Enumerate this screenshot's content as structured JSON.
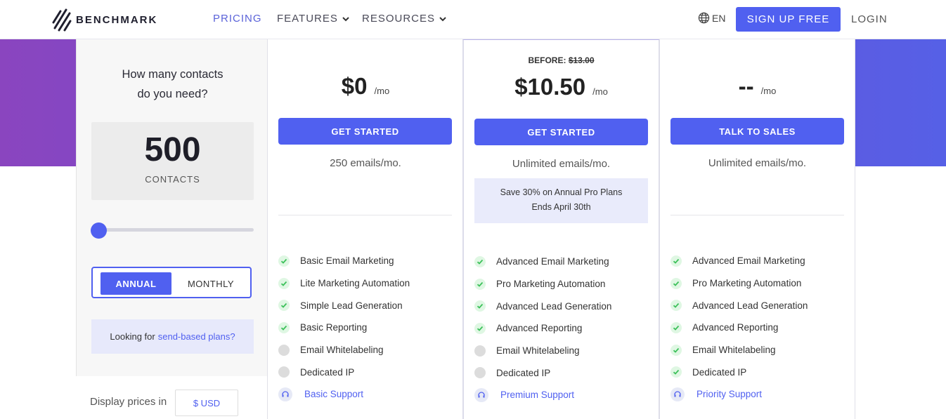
{
  "header": {
    "logo_text": "BENCHMARK",
    "nav": [
      {
        "label": "PRICING",
        "active": true,
        "dropdown": false
      },
      {
        "label": "FEATURES",
        "active": false,
        "dropdown": true
      },
      {
        "label": "RESOURCES",
        "active": false,
        "dropdown": true
      }
    ],
    "lang": "EN",
    "signup": "SIGN UP FREE",
    "login": "LOGIN"
  },
  "sidebar": {
    "question": "How many contacts\ndo you need?",
    "contacts_value": "500",
    "contacts_label": "CONTACTS",
    "slider_value": 0,
    "toggle": {
      "annual": "ANNUAL",
      "monthly": "MONTHLY",
      "selected": "ANNUAL"
    },
    "send_based_prefix": "Looking for",
    "send_based_link": "send-based plans?",
    "display_prices": "Display prices in",
    "currency": "$ USD"
  },
  "plans": [
    {
      "before_label": "",
      "before_price": "",
      "price": "$0",
      "per": "/mo",
      "button": "GET STARTED",
      "emails": "250 emails/mo.",
      "promo": "",
      "features": [
        {
          "label": "Basic Email Marketing",
          "included": true
        },
        {
          "label": "Lite Marketing Automation",
          "included": true
        },
        {
          "label": "Simple Lead Generation",
          "included": true
        },
        {
          "label": "Basic Reporting",
          "included": true
        },
        {
          "label": "Email Whitelabeling",
          "included": false
        },
        {
          "label": "Dedicated IP",
          "included": false
        }
      ],
      "support": "Basic Support"
    },
    {
      "before_label": "BEFORE:",
      "before_price": "$13.00",
      "price": "$10.50",
      "per": "/mo",
      "button": "GET STARTED",
      "emails": "Unlimited emails/mo.",
      "promo": "Save 30% on Annual Pro Plans\nEnds April 30th",
      "features": [
        {
          "label": "Advanced Email Marketing",
          "included": true
        },
        {
          "label": "Pro Marketing Automation",
          "included": true
        },
        {
          "label": "Advanced Lead Generation",
          "included": true
        },
        {
          "label": "Advanced Reporting",
          "included": true
        },
        {
          "label": "Email Whitelabeling",
          "included": false
        },
        {
          "label": "Dedicated IP",
          "included": false
        }
      ],
      "support": "Premium Support"
    },
    {
      "before_label": "",
      "before_price": "",
      "price": "--",
      "per": "/mo",
      "button": "TALK TO SALES",
      "emails": "Unlimited emails/mo.",
      "promo": "",
      "features": [
        {
          "label": "Advanced Email Marketing",
          "included": true
        },
        {
          "label": "Pro Marketing Automation",
          "included": true
        },
        {
          "label": "Advanced Lead Generation",
          "included": true
        },
        {
          "label": "Advanced Reporting",
          "included": true
        },
        {
          "label": "Email Whitelabeling",
          "included": true
        },
        {
          "label": "Dedicated IP",
          "included": true
        }
      ],
      "support": "Priority Support"
    }
  ],
  "colors": {
    "accent": "#5060f0",
    "band_start": "#8a45bf",
    "band_end": "#5660e6",
    "check": "#3cc15a"
  }
}
